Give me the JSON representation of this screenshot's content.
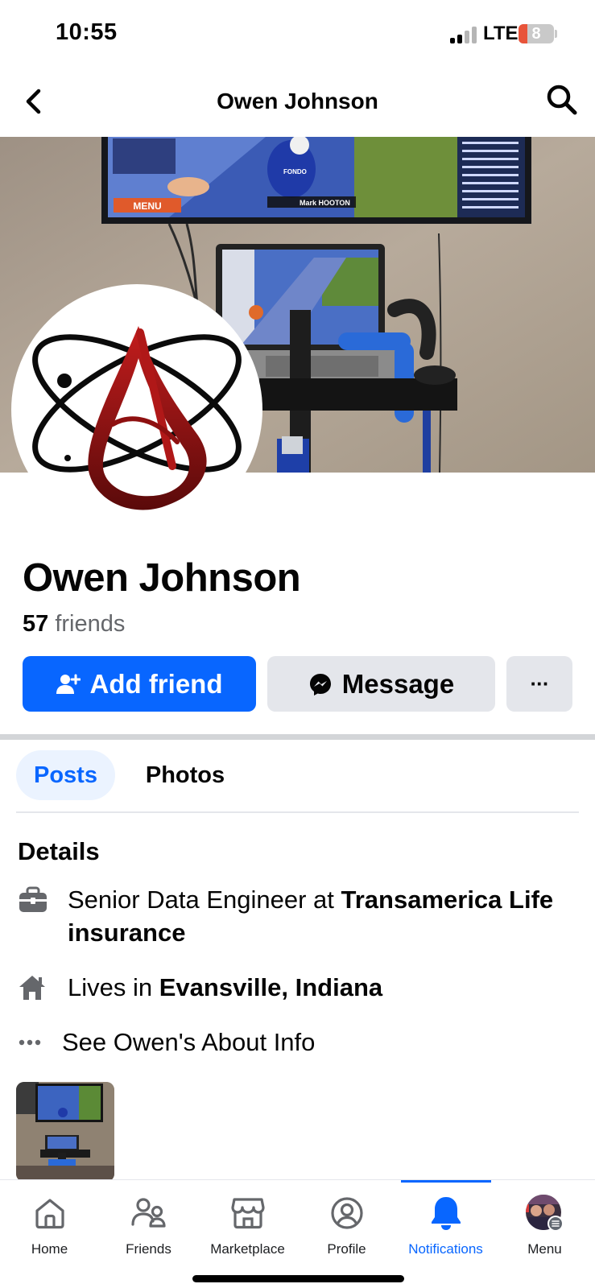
{
  "status_bar": {
    "time": "10:55",
    "network": "LTE",
    "battery": "8",
    "battery_level": 0.08
  },
  "top_nav": {
    "title": "Owen Johnson"
  },
  "profile": {
    "name": "Owen Johnson",
    "friends_count": "57",
    "friends_label": "friends"
  },
  "actions": {
    "add_friend": "Add friend",
    "message": "Message",
    "more": "···"
  },
  "tabs": [
    {
      "label": "Posts",
      "active": true
    },
    {
      "label": "Photos",
      "active": false
    }
  ],
  "details": {
    "title": "Details",
    "work_prefix": "Senior Data Engineer at ",
    "work_company": "Transamerica Life insurance",
    "home_prefix": "Lives in ",
    "home_city": "Evansville, Indiana",
    "about_link": "See Owen's About Info"
  },
  "cover_screen": {
    "menu_label": "MENU",
    "rider_label": "Mark HOOTON",
    "brand_label": "FONDO"
  },
  "bottom_nav": [
    {
      "label": "Home",
      "icon": "home-icon",
      "active": false
    },
    {
      "label": "Friends",
      "icon": "friends-icon",
      "active": false
    },
    {
      "label": "Marketplace",
      "icon": "marketplace-icon",
      "active": false
    },
    {
      "label": "Profile",
      "icon": "profile-icon",
      "active": false
    },
    {
      "label": "Notifications",
      "icon": "bell-icon",
      "active": true
    },
    {
      "label": "Menu",
      "icon": "menu-avatar-icon",
      "active": false
    }
  ],
  "colors": {
    "primary": "#0866ff",
    "secondary_button": "#e4e6eb",
    "active_tab_bg": "#ebf3ff",
    "battery_low": "#e8543a",
    "logo_red": "#a11d1d"
  }
}
